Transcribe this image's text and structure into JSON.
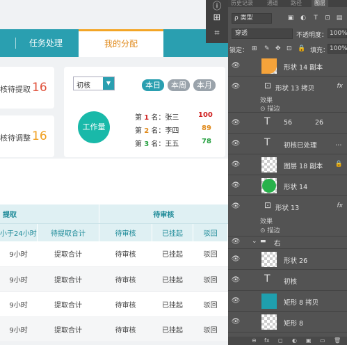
{
  "web": {
    "nav": {
      "tab_arrow": "›",
      "tab_tasks": "任务处理",
      "tab_mine": "我的分配"
    },
    "stats": [
      {
        "label": "核待提取",
        "value": "16",
        "color": "#e0523c"
      },
      {
        "label": "核待调整",
        "value": "16",
        "color": "#f0a020"
      }
    ],
    "filter": {
      "selected": "初核",
      "arrow": "▼"
    },
    "periods": [
      {
        "label": "本日",
        "color": "#2a9fb0"
      },
      {
        "label": "本周",
        "color": "#9aa3ab"
      },
      {
        "label": "本月",
        "color": "#9aa3ab"
      }
    ],
    "workload_label": "工作量",
    "ranking": [
      {
        "prefix": "第",
        "n": "1",
        "suffix": "名：张三",
        "score": "100",
        "color": "#d02020"
      },
      {
        "prefix": "第",
        "n": "2",
        "suffix": "名：李四",
        "score": "89",
        "color": "#e08a1c"
      },
      {
        "prefix": "第",
        "n": "3",
        "suffix": "名：王五",
        "score": "78",
        "color": "#26a040"
      }
    ],
    "table": {
      "group_headers": [
        "提取",
        "待审核"
      ],
      "columns": [
        "小于24小时",
        "待提取合计",
        "待审核",
        "已挂起",
        "驳回"
      ],
      "rows": [
        [
          "9小时",
          "提取合计",
          "待审核",
          "已挂起",
          "驳回"
        ],
        [
          "9小时",
          "提取合计",
          "待审核",
          "已挂起",
          "驳回"
        ],
        [
          "9小时",
          "提取合计",
          "待审核",
          "已挂起",
          "驳回"
        ],
        [
          "9小时",
          "提取合计",
          "待审核",
          "已挂起",
          "驳回"
        ]
      ]
    }
  },
  "photoshop": {
    "tabs": [
      "历史记录",
      "通道",
      "路径",
      "图层"
    ],
    "kind_filter": "ρ 类型",
    "blend_mode": "穿透",
    "opacity_label": "不透明度：",
    "opacity_value": "100%",
    "lock_label": "锁定：",
    "fill_label": "填充：",
    "fill_value": "100%",
    "effects_label": "效果",
    "stroke_label": "描边",
    "fx": "fx",
    "layers": [
      {
        "name": "形状 14 副本",
        "thumb": "orange"
      },
      {
        "name": "形状 13 拷贝",
        "thumb": "smart",
        "fx": true
      },
      {
        "name": "56",
        "thumb": "text",
        "extra": "26"
      },
      {
        "name": "初核已处理",
        "thumb": "text",
        "extra": "…"
      },
      {
        "name": "图层 18 副本",
        "thumb": "checker",
        "lock": true
      },
      {
        "name": "形状 14",
        "thumb": "green"
      },
      {
        "name": "形状 13",
        "thumb": "smart",
        "fx": true
      },
      {
        "name": "右",
        "thumb": "folder"
      },
      {
        "name": "形状 26",
        "thumb": "checker"
      },
      {
        "name": "初核",
        "thumb": "text"
      },
      {
        "name": "矩形 8 拷贝",
        "thumb": "teal"
      },
      {
        "name": "矩形 8",
        "thumb": "checker"
      }
    ],
    "bottom_icons": [
      "⊖",
      "fx",
      "◻",
      "◐",
      "▣",
      "▭",
      "🗑"
    ]
  },
  "tools": [
    "ⓘ",
    "⊞",
    "⌗"
  ]
}
